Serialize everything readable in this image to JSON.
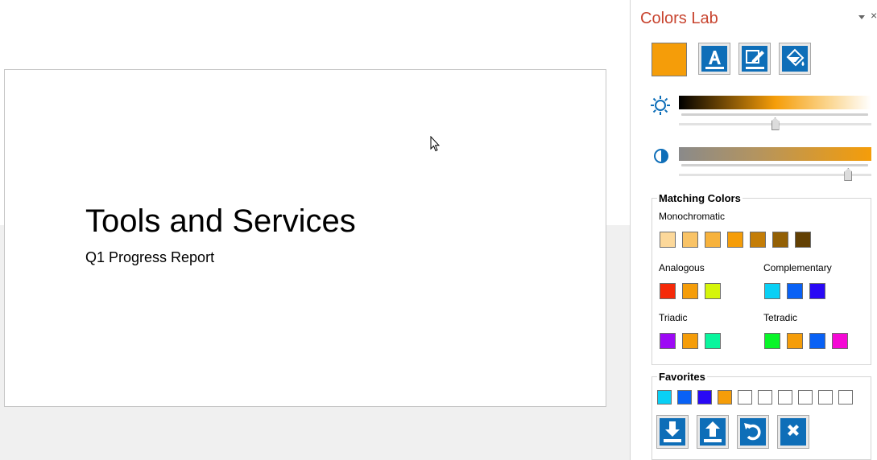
{
  "slide": {
    "title": "Tools and Services",
    "subtitle": "Q1 Progress Report"
  },
  "pane": {
    "title": "Colors Lab",
    "title_color": "#c8442f",
    "close_glyph": "×",
    "current_color": "#f59d09",
    "tool_buttons": [
      {
        "name": "font-color-icon"
      },
      {
        "name": "line-color-icon"
      },
      {
        "name": "fill-color-icon"
      }
    ],
    "brightness_icon": "sun-icon",
    "saturation_icon": "contrast-icon",
    "brightness_level": 0.5,
    "saturation_level": 0.88,
    "matching": {
      "title": "Matching Colors",
      "monochromatic": {
        "label": "Monochromatic",
        "colors": [
          "#fcd89a",
          "#f9c366",
          "#f7b23c",
          "#f59d09",
          "#c47d07",
          "#936005",
          "#624003"
        ]
      },
      "analogous": {
        "label": "Analogous",
        "colors": [
          "#f52909",
          "#f59d09",
          "#d5f509"
        ]
      },
      "complementary": {
        "label": "Complementary",
        "colors": [
          "#09d0f5",
          "#0961f5",
          "#2909f5"
        ]
      },
      "triadic": {
        "label": "Triadic",
        "colors": [
          "#9d09f5",
          "#f59d09",
          "#09f59d"
        ]
      },
      "tetradic": {
        "label": "Tetradic",
        "colors": [
          "#09f529",
          "#f59d09",
          "#0961f5",
          "#f509d5"
        ]
      }
    },
    "favorites": {
      "title": "Favorites",
      "colors": [
        "#09d0f5",
        "#0961f5",
        "#2909f5",
        "#f59d09",
        "#ffffff",
        "#ffffff",
        "#ffffff",
        "#ffffff",
        "#ffffff",
        "#ffffff"
      ]
    },
    "actions": [
      {
        "name": "import-favorites-icon"
      },
      {
        "name": "export-favorites-icon"
      },
      {
        "name": "reset-favorites-icon"
      },
      {
        "name": "clear-favorites-icon"
      }
    ]
  }
}
